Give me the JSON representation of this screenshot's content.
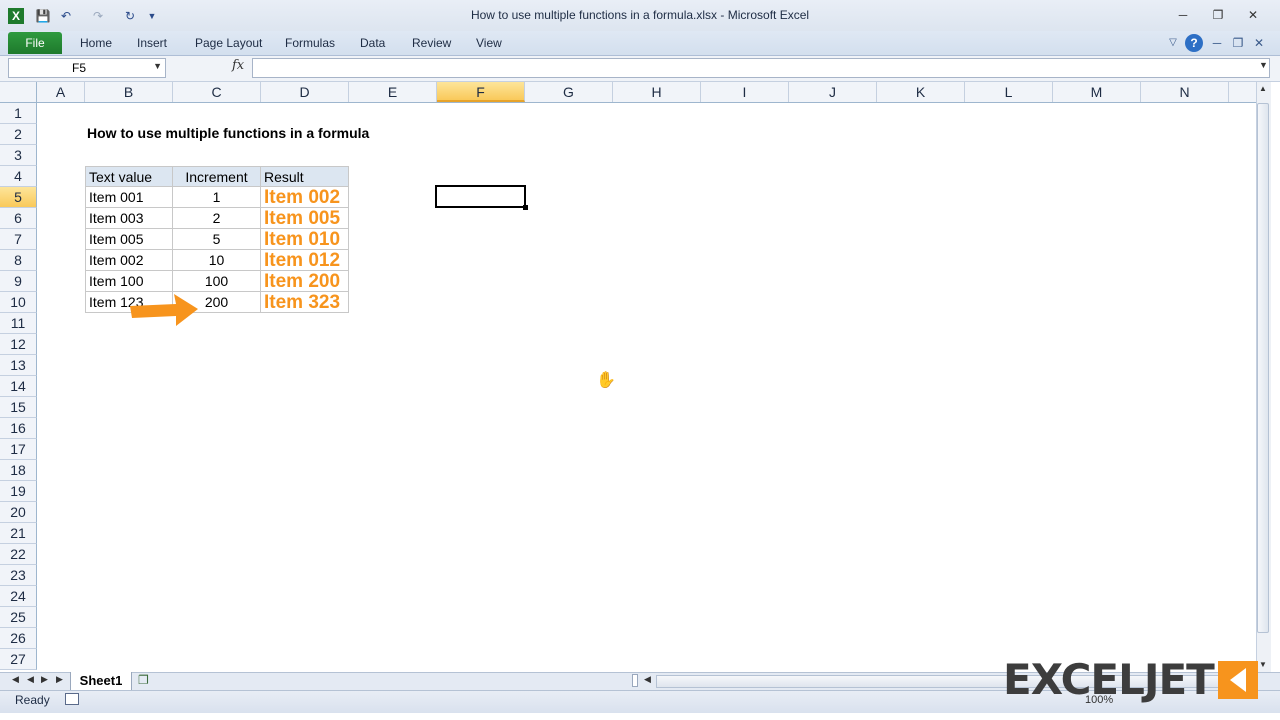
{
  "window": {
    "title": "How to use multiple functions in a formula.xlsx  -  Microsoft Excel"
  },
  "ribbon": {
    "file": "File",
    "tabs": [
      "Home",
      "Insert",
      "Page Layout",
      "Formulas",
      "Data",
      "Review",
      "View"
    ]
  },
  "formula_bar": {
    "name_box": "F5",
    "fx": "fx",
    "value": ""
  },
  "columns": [
    "A",
    "B",
    "C",
    "D",
    "E",
    "F",
    "G",
    "H",
    "I",
    "J",
    "K",
    "L",
    "M",
    "N"
  ],
  "selected_column": "F",
  "rows": [
    "1",
    "2",
    "3",
    "4",
    "5",
    "6",
    "7",
    "8",
    "9",
    "10",
    "11",
    "12",
    "13",
    "14",
    "15",
    "16",
    "17",
    "18",
    "19",
    "20",
    "21",
    "22",
    "23",
    "24",
    "25",
    "26",
    "27"
  ],
  "selected_row": "5",
  "sheet": {
    "title": "How to use multiple functions in a formula",
    "headers": {
      "text_value": "Text value",
      "increment": "Increment",
      "result": "Result"
    },
    "data": [
      {
        "text": "Item 001",
        "inc": "1",
        "result": "Item 002"
      },
      {
        "text": "Item 003",
        "inc": "2",
        "result": "Item 005"
      },
      {
        "text": "Item 005",
        "inc": "5",
        "result": "Item 010"
      },
      {
        "text": "Item 002",
        "inc": "10",
        "result": "Item 012"
      },
      {
        "text": "Item 100",
        "inc": "100",
        "result": "Item 200"
      },
      {
        "text": "Item 123",
        "inc": "200",
        "result": "Item 323"
      }
    ]
  },
  "sheet_tabs": {
    "active": "Sheet1"
  },
  "status": {
    "ready": "Ready",
    "zoom": "100%"
  },
  "logo": {
    "text": "EXCELJET"
  },
  "colors": {
    "accent": "#f7941d",
    "file_tab": "#2f9a3f",
    "header_fill": "#dce6f1"
  }
}
